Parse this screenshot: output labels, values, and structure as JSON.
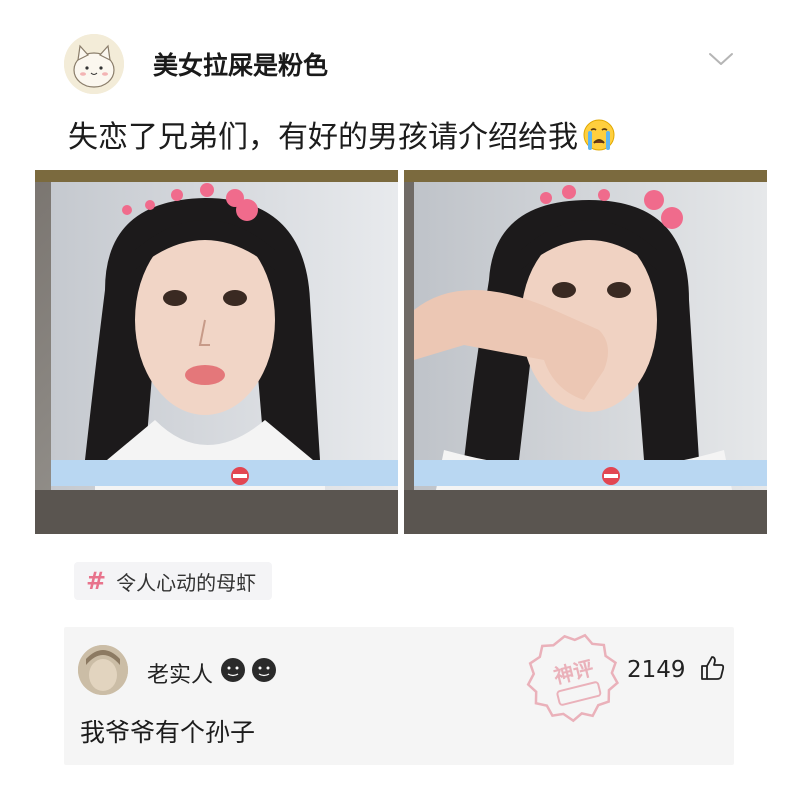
{
  "post": {
    "username": "美女拉屎是粉色",
    "text": "失恋了兄弟们，有好的男孩请介绍给我",
    "text_emoji": "crying-face-emoji",
    "images": [
      "selfie-photo-1",
      "selfie-photo-2"
    ],
    "topic_tag": "令人心动的母虾"
  },
  "comment": {
    "username": "老实人",
    "badges": [
      "black-face-emoji",
      "black-face-emoji"
    ],
    "stamp": "神评",
    "like_count": "2149",
    "text": "我爷爷有个孙子"
  },
  "colors": {
    "background": "#ffffff",
    "topic_hash": "#e8738c",
    "comment_background": "#f5f5f5",
    "stamp": "#e27a8a"
  }
}
